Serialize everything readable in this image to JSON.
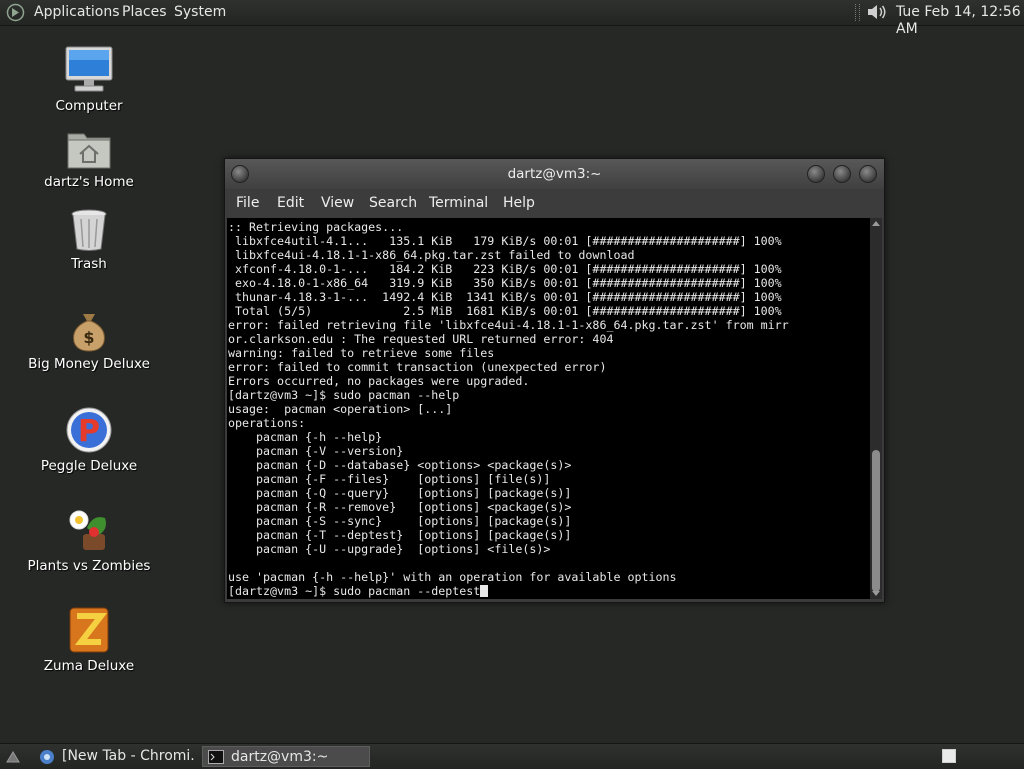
{
  "top_panel": {
    "menu": [
      "Applications",
      "Places",
      "System"
    ],
    "clock": "Tue Feb 14, 12:56 AM"
  },
  "desktop_icons": [
    {
      "label": "Computer",
      "icon": "computer-icon"
    },
    {
      "label": "dartz's Home",
      "icon": "home-folder-icon"
    },
    {
      "label": "Trash",
      "icon": "trash-icon"
    },
    {
      "label": "Big Money Deluxe",
      "icon": "money-bag-icon"
    },
    {
      "label": "Peggle Deluxe",
      "icon": "peggle-icon"
    },
    {
      "label": "Plants vs Zombies",
      "icon": "plants-vs-zombies-icon"
    },
    {
      "label": "Zuma Deluxe",
      "icon": "zuma-icon"
    }
  ],
  "terminal": {
    "title": "dartz@vm3:~",
    "menu": [
      "File",
      "Edit",
      "View",
      "Search",
      "Terminal",
      "Help"
    ],
    "lines": [
      ":: Retrieving packages...",
      " libxfce4util-4.1...   135.1 KiB   179 KiB/s 00:01 [#####################] 100%",
      " libxfce4ui-4.18.1-1-x86_64.pkg.tar.zst failed to download",
      " xfconf-4.18.0-1-...   184.2 KiB   223 KiB/s 00:01 [#####################] 100%",
      " exo-4.18.0-1-x86_64   319.9 KiB   350 KiB/s 00:01 [#####################] 100%",
      " thunar-4.18.3-1-...  1492.4 KiB  1341 KiB/s 00:01 [#####################] 100%",
      " Total (5/5)             2.5 MiB  1681 KiB/s 00:01 [#####################] 100%",
      "error: failed retrieving file 'libxfce4ui-4.18.1-1-x86_64.pkg.tar.zst' from mirr",
      "or.clarkson.edu : The requested URL returned error: 404",
      "warning: failed to retrieve some files",
      "error: failed to commit transaction (unexpected error)",
      "Errors occurred, no packages were upgraded.",
      "[dartz@vm3 ~]$ sudo pacman --help",
      "usage:  pacman <operation> [...]",
      "operations:",
      "    pacman {-h --help}",
      "    pacman {-V --version}",
      "    pacman {-D --database} <options> <package(s)>",
      "    pacman {-F --files}    [options] [file(s)]",
      "    pacman {-Q --query}    [options] [package(s)]",
      "    pacman {-R --remove}   [options] <package(s)>",
      "    pacman {-S --sync}     [options] [package(s)]",
      "    pacman {-T --deptest}  [options] [package(s)]",
      "    pacman {-U --upgrade}  [options] <file(s)>",
      "",
      "use 'pacman {-h --help}' with an operation for available options"
    ],
    "prompt_line": "[dartz@vm3 ~]$ sudo pacman --deptest"
  },
  "taskbar": {
    "tasks": [
      {
        "label": "[New Tab - Chromi...",
        "icon": "chromium-icon"
      },
      {
        "label": "dartz@vm3:~",
        "icon": "terminal-icon"
      }
    ]
  }
}
